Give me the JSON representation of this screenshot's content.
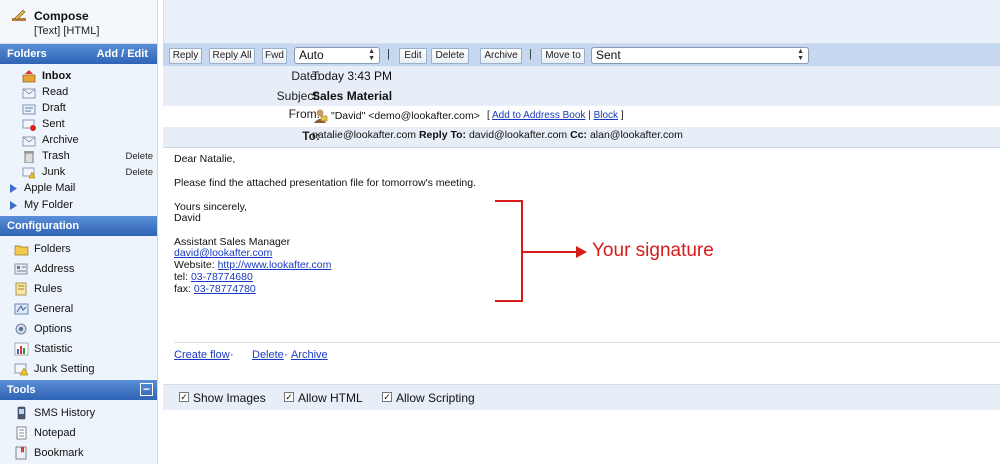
{
  "compose": {
    "title": "Compose",
    "links": "[Text] [HTML]"
  },
  "folders": {
    "header": "Folders",
    "action": "Add / Edit",
    "items": [
      {
        "label": "Inbox",
        "icon": "inbox-icon",
        "bold": true
      },
      {
        "label": "Read",
        "icon": "read-folder-icon"
      },
      {
        "label": "Draft",
        "icon": "draft-icon"
      },
      {
        "label": "Sent",
        "icon": "sent-icon"
      },
      {
        "label": "Archive",
        "icon": "archive-icon"
      },
      {
        "label": "Trash",
        "icon": "trash-icon",
        "action": "Delete"
      },
      {
        "label": "Junk",
        "icon": "junk-icon",
        "action": "Delete"
      }
    ],
    "subfolders": [
      {
        "label": "Apple Mail"
      },
      {
        "label": "My Folder"
      }
    ]
  },
  "configuration": {
    "header": "Configuration",
    "items": [
      {
        "label": "Folders",
        "icon": "folders-config-icon"
      },
      {
        "label": "Address",
        "icon": "address-icon"
      },
      {
        "label": "Rules",
        "icon": "rules-icon"
      },
      {
        "label": "General",
        "icon": "general-icon"
      },
      {
        "label": "Options",
        "icon": "options-icon"
      },
      {
        "label": "Statistic",
        "icon": "statistic-icon"
      },
      {
        "label": "Junk Setting",
        "icon": "junk-setting-icon"
      }
    ]
  },
  "tools": {
    "header": "Tools",
    "collapse": "−",
    "items": [
      {
        "label": "SMS History",
        "icon": "sms-icon"
      },
      {
        "label": "Notepad",
        "icon": "notepad-icon"
      },
      {
        "label": "Bookmark",
        "icon": "bookmark-icon"
      }
    ]
  },
  "toolbar": {
    "reply": "Reply",
    "reply_all": "Reply All",
    "fwd": "Fwd",
    "fwd_mode": "Auto",
    "sep": "|",
    "edit": "Edit",
    "delete": "Delete",
    "archive": "Archive",
    "move_to": "Move to",
    "move_target": "Sent"
  },
  "message": {
    "date_label": "Date:",
    "date": "Today 3:43 PM",
    "subject_label": "Subject:",
    "subject": "Sales Material",
    "from_label": "From:",
    "from": "\"David\" <demo@lookafter.com>",
    "add_to_address_book": "Add to Address Book",
    "block": "Block",
    "from_bracket_open": "[",
    "from_bracket_sep": "|",
    "from_bracket_close": "]",
    "to_label": "To:",
    "to": "natalie@lookafter.com",
    "reply_to_label": "Reply To:",
    "reply_to": "david@lookafter.com",
    "cc_label": "Cc:",
    "cc": "alan@lookafter.com",
    "body": {
      "greeting": "Dear Natalie,",
      "line1": "Please find the attached presentation file for tomorrow's meeting.",
      "closing": "Yours sincerely,",
      "name": "David",
      "title": "Assistant Sales Manager",
      "email": "david@lookafter.com",
      "website_label": "Website:",
      "website": "http://www.lookafter.com",
      "tel_label": "tel:",
      "tel": "03-78774680",
      "fax_label": "fax:",
      "fax": "03-78774780"
    },
    "annotation": "Your signature"
  },
  "actions": {
    "create_flow": "Create flow",
    "dot": "·",
    "delete": "Delete",
    "archive": "Archive"
  },
  "options": {
    "show_images": "Show Images",
    "allow_html": "Allow HTML",
    "allow_scripting": "Allow Scripting",
    "check": "✓"
  },
  "colors": {
    "accent": "#2f63b5",
    "link": "#1a3bc1",
    "annotation": "#d81b1b"
  }
}
